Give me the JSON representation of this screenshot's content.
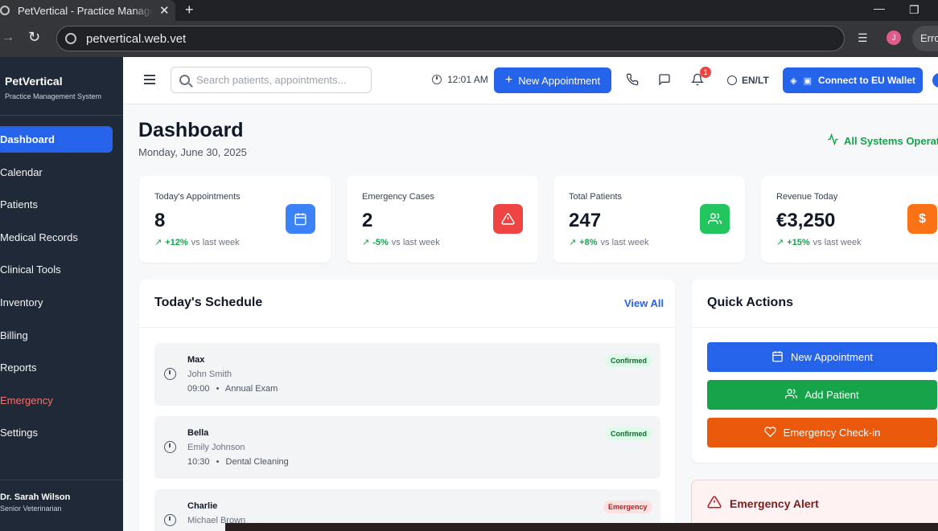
{
  "browser": {
    "tab_title": "PetVertical - Practice Management",
    "tab_close": "✕",
    "new_tab": "+",
    "url": "petvertical.web.vet",
    "profile_initial": "J",
    "error_pill": "Erro"
  },
  "sidebar": {
    "brand_name": "PetVertical",
    "brand_sub": "Practice Management System",
    "items": [
      {
        "label": "Dashboard"
      },
      {
        "label": "Calendar"
      },
      {
        "label": "Patients"
      },
      {
        "label": "Medical Records"
      },
      {
        "label": "Clinical Tools"
      },
      {
        "label": "Inventory"
      },
      {
        "label": "Billing"
      },
      {
        "label": "Reports"
      },
      {
        "label": "Emergency"
      },
      {
        "label": "Settings"
      }
    ],
    "user_name": "Dr. Sarah Wilson",
    "user_role": "Senior Veterinarian"
  },
  "header": {
    "search_placeholder": "Search patients, appointments...",
    "time": "12:01 AM",
    "new_appointment_label": "New Appointment",
    "notification_count": "1",
    "language": "EN/LT",
    "wallet_label": "Connect to EU Wallet"
  },
  "page": {
    "title": "Dashboard",
    "date": "Monday, June 30, 2025",
    "system_status": "All Systems Operational"
  },
  "stats": [
    {
      "label": "Today's Appointments",
      "value": "8",
      "trend": "+12%",
      "trend_suffix": "vs last week",
      "icon": "calendar-icon",
      "color": "#3b82f6"
    },
    {
      "label": "Emergency Cases",
      "value": "2",
      "trend": "-5%",
      "trend_suffix": "vs last week",
      "icon": "warning-icon",
      "color": "#ef4444"
    },
    {
      "label": "Total Patients",
      "value": "247",
      "trend": "+8%",
      "trend_suffix": "vs last week",
      "icon": "users-icon",
      "color": "#22c55e"
    },
    {
      "label": "Revenue Today",
      "value": "€3,250",
      "trend": "+15%",
      "trend_suffix": "vs last week",
      "icon": "dollar-icon",
      "color": "#f97316"
    }
  ],
  "schedule": {
    "title": "Today's Schedule",
    "view_all": "View All",
    "appointments": [
      {
        "pet": "Max",
        "owner": "John Smith",
        "time": "09:00",
        "type": "Annual Exam",
        "status": "Confirmed"
      },
      {
        "pet": "Bella",
        "owner": "Emily Johnson",
        "time": "10:30",
        "type": "Dental Cleaning",
        "status": "Confirmed"
      },
      {
        "pet": "Charlie",
        "owner": "Michael Brown",
        "status": "Emergency"
      }
    ],
    "separator": "•"
  },
  "quick_actions": {
    "title": "Quick Actions",
    "buttons": [
      {
        "label": "New Appointment",
        "color": "#2563eb",
        "icon": "calendar-icon"
      },
      {
        "label": "Add Patient",
        "color": "#16a34a",
        "icon": "users-icon"
      },
      {
        "label": "Emergency Check-in",
        "color": "#ea580c",
        "icon": "heart-icon"
      }
    ]
  },
  "alert": {
    "title": "Emergency Alert"
  }
}
